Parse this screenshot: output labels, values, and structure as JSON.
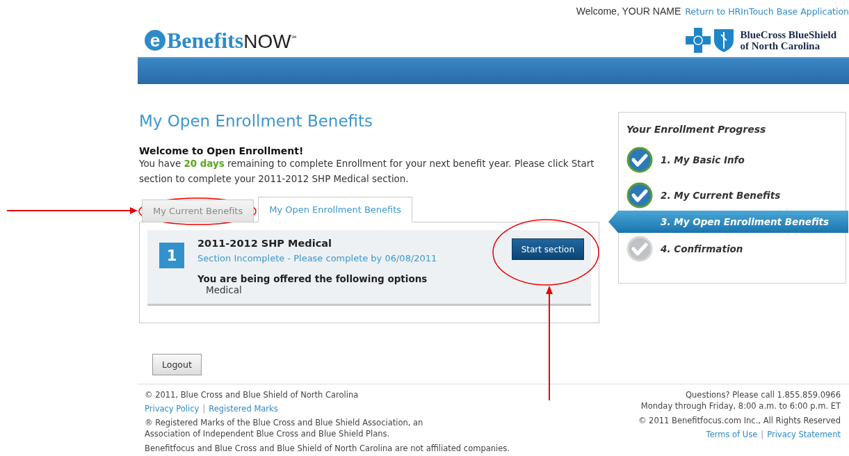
{
  "header": {
    "welcome": "Welcome, YOUR NAME",
    "return_link": "Return to HRInTouch Base Application",
    "logo": {
      "letter": "e",
      "name": "Benefits",
      "suffix": "NOW",
      "mark": "℠"
    },
    "partner_logo": {
      "line_1": "BlueCross BlueShield",
      "line_2": "of North Carolina"
    }
  },
  "page_title": "My Open Enrollment Benefits",
  "intro": {
    "heading": "Welcome to Open Enrollment!",
    "text": "You have **20 days** remaining to complete Enrollment for your next benefit year. Please click Start section to complete your 2011-2012 SHP Medical section."
  },
  "tabs": [
    {
      "label": "My Current Benefits",
      "selected": false
    },
    {
      "label": "My Open Enrollment Benefits",
      "selected": true
    }
  ],
  "sections": [
    {
      "number": "1",
      "title": "2011-2012 SHP Medical",
      "status": "Section Incomplete - Please complete by 06/08/2011",
      "offer_label": "You are being offered the following options",
      "options": [
        "Medical"
      ],
      "button": "Start section"
    }
  ],
  "logout": "Logout",
  "progress": {
    "title": "Your Enrollment Progress",
    "steps": [
      {
        "label": "1. My Basic Info",
        "done": true,
        "selected": false
      },
      {
        "label": "2. My Current Benefits",
        "done": true,
        "selected": false
      },
      {
        "label": "3. My Open Enrollment Benefits",
        "selected": true
      },
      {
        "label": "4. Confirmation",
        "done": false,
        "selected": false
      }
    ]
  },
  "footer": {
    "copyright": "© 2011, Blue Cross and Blue Shield of North Carolina",
    "left_links": [
      "Privacy Policy",
      "Registered Marks"
    ],
    "left_separator": "|",
    "right_separator": "|",
    "registered_note": "® Registered Marks of the Blue Cross and Blue Shield Association, an Association of Independent Blue Cross and Blue Shield Plans.",
    "disclaimer": "Benefitfocus and Blue Cross and Blue Shield of North Carolina are not affiliated companies.",
    "questions": "Questions? Please call 1.855.859.0966",
    "hours": "Monday through Friday, 8:00 a.m. to 6:00 p.m. ET",
    "rights": "© 2011 Benefitfocus.com Inc., All Rights Reserved",
    "right_links": [
      "Terms of Use",
      "Privacy Statement"
    ]
  }
}
